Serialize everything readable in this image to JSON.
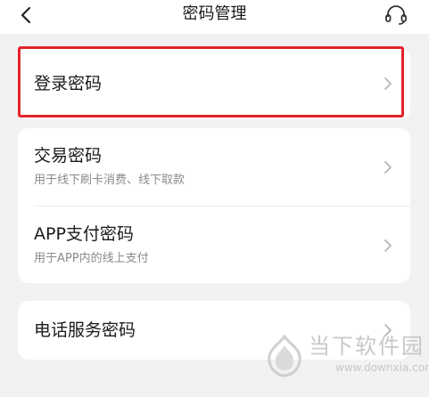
{
  "header": {
    "title": "密码管理",
    "back_icon": "chevron-left-icon",
    "support_icon": "headset-icon"
  },
  "items": [
    {
      "label": "登录密码"
    },
    {
      "label": "交易密码",
      "subtitle": "用于线下刷卡消费、线下取款"
    },
    {
      "label": "APP支付密码",
      "subtitle": "用于APP内的线上支付"
    },
    {
      "label": "电话服务密码"
    }
  ],
  "watermark": {
    "text": "当下软件园",
    "url": "www.downxia.com"
  },
  "colors": {
    "background": "#f2f2f2",
    "card": "#ffffff",
    "highlight": "#e5242a",
    "subtitle": "#8a8a8a",
    "chevron": "#b5b5b5"
  }
}
